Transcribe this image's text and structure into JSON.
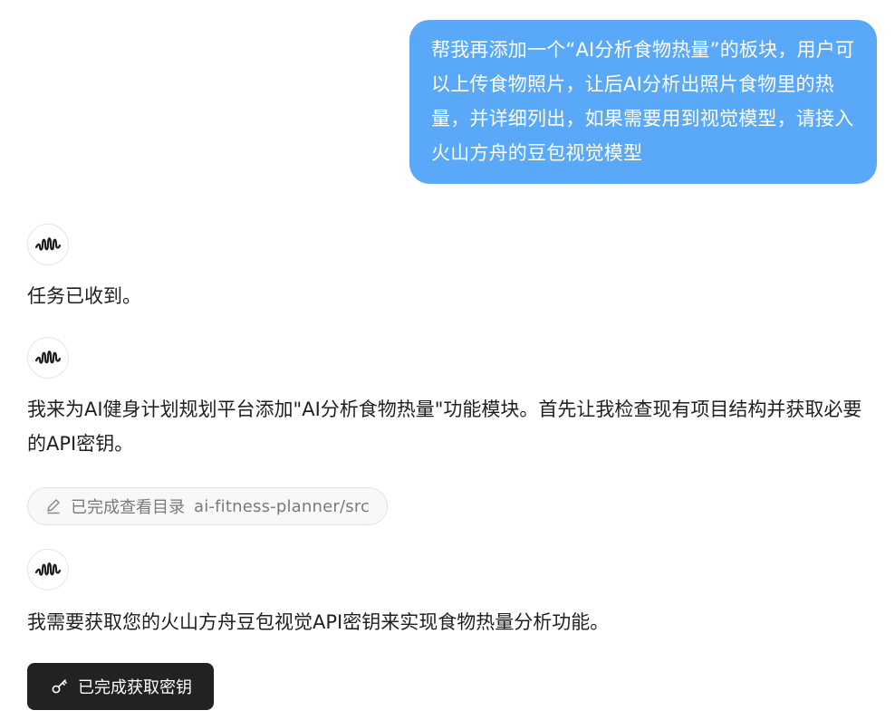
{
  "user_message": {
    "text": "帮我再添加一个“AI分析食物热量”的板块，用户可以上传食物照片，让后AI分析出照片食物里的热量，并详细列出，如果需要用到视觉模型，请接入火山方舟的豆包视觉模型",
    "bubble_color": "#5aa8f8"
  },
  "assistant": {
    "icon": "waveform-icon",
    "messages": [
      {
        "text": "任务已收到。"
      },
      {
        "text": "我来为AI健身计划规划平台添加\"AI分析食物热量\"功能模块。首先让我检查现有项目结构并获取必要的API密钥。"
      },
      {
        "text": "我需要获取您的火山方舟豆包视觉API密钥来实现食物热量分析功能。"
      }
    ]
  },
  "tool_chip": {
    "icon": "pencil-icon",
    "status": "已完成查看目录",
    "path": "ai-fitness-planner/src"
  },
  "key_button": {
    "icon": "key-icon",
    "label": "已完成获取密钥"
  }
}
